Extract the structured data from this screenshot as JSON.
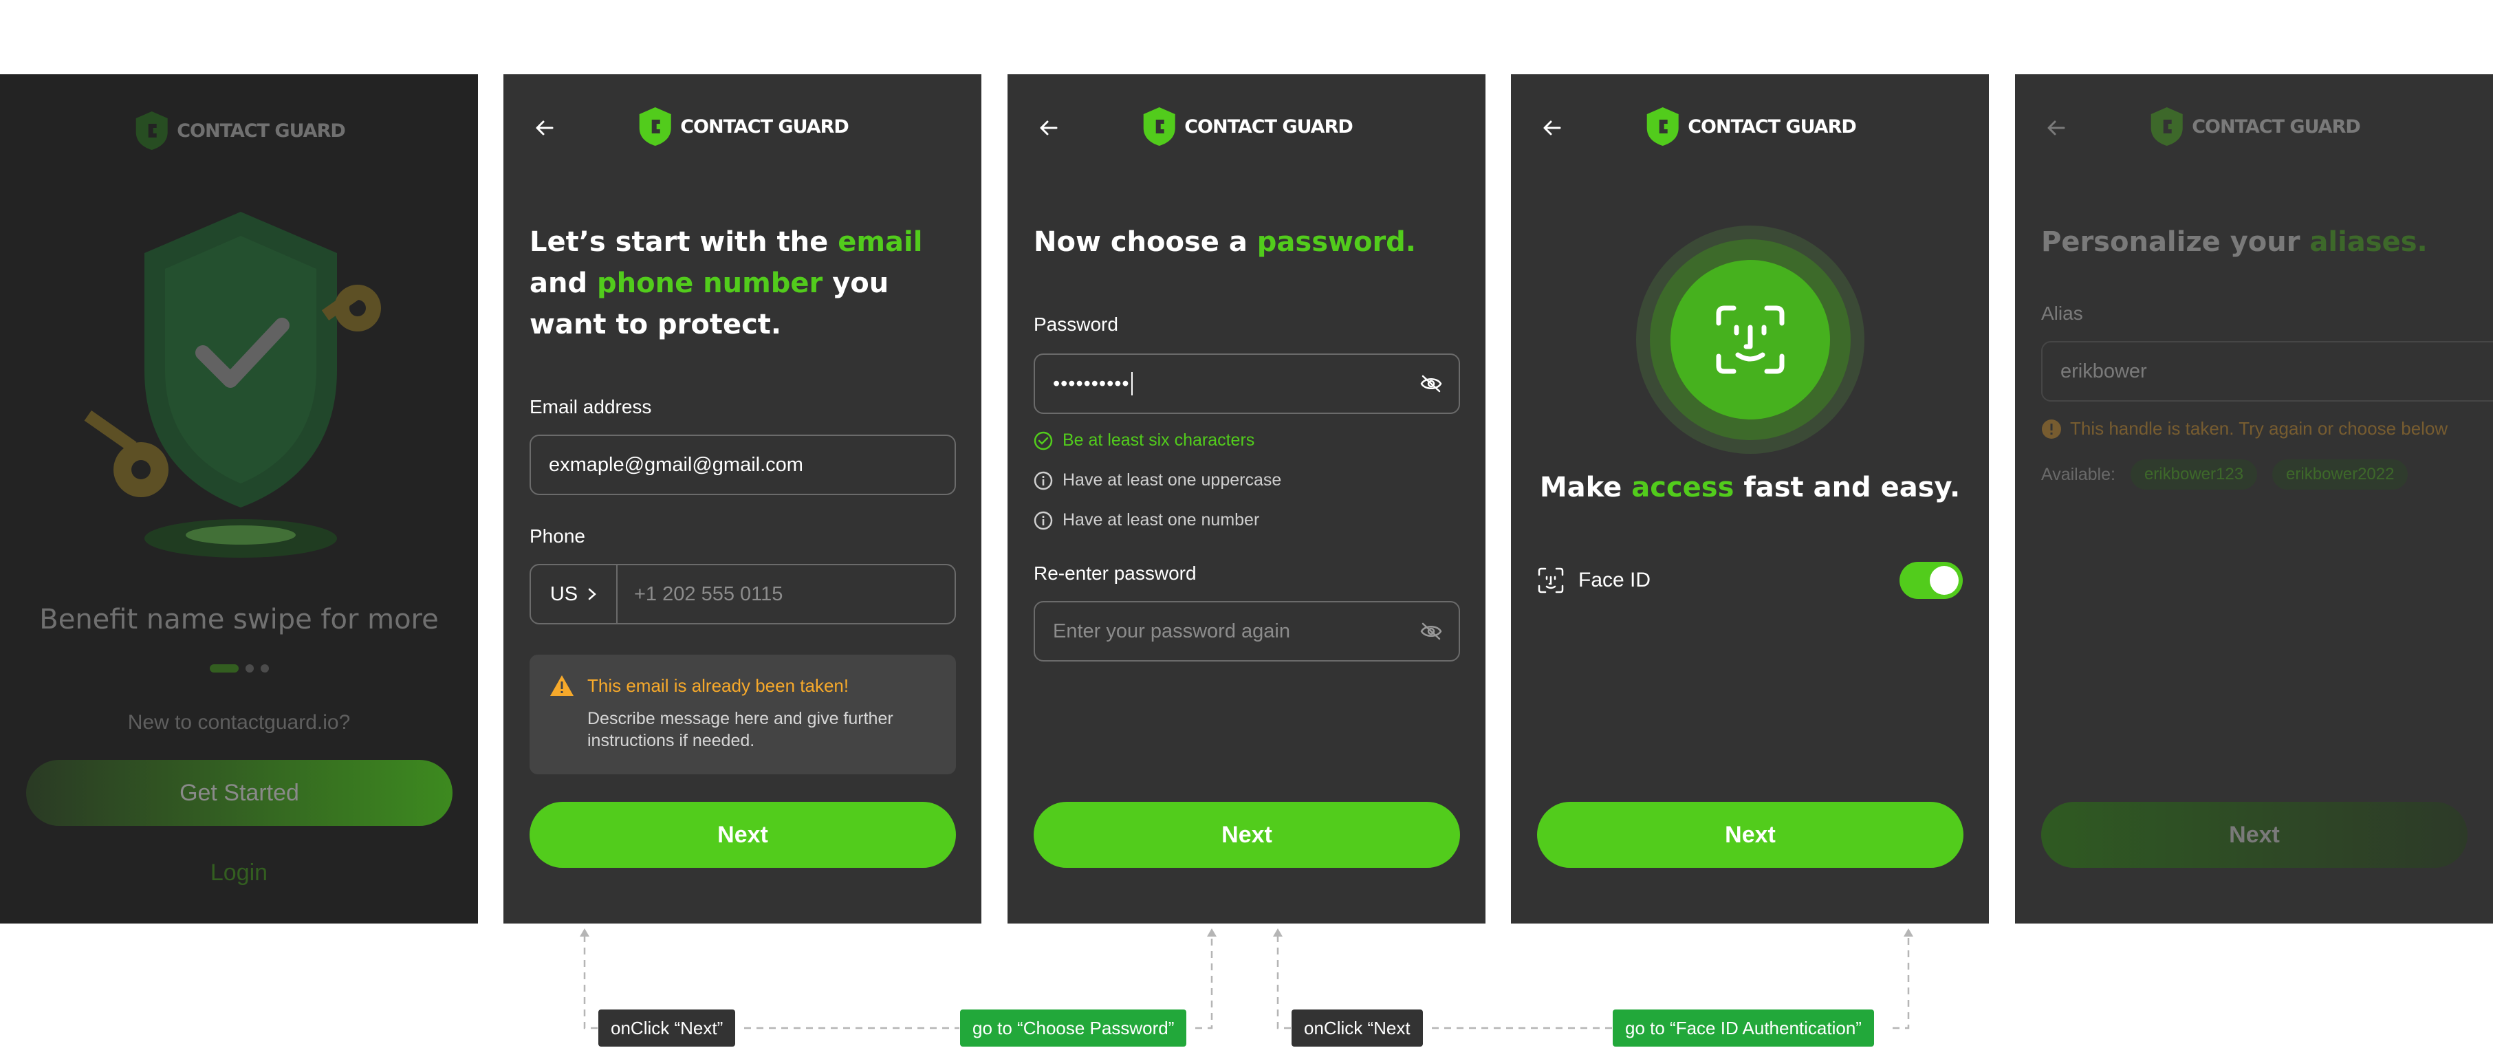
{
  "brand": {
    "name": "CONTACT GUARD",
    "accent": "#52cc1c",
    "screen_bg": "#333333"
  },
  "screen1": {
    "tagline": "Benefit name swipe for more",
    "new_user": "New to contactguard.io?",
    "get_started": "Get Started",
    "login": "Login",
    "pagination": {
      "total": 3,
      "active": 1
    }
  },
  "screen2": {
    "title_part1": "Let’s start with the ",
    "title_accent1": "email",
    "title_part2": " and ",
    "title_accent2": "phone number",
    "title_part3": " you want to protect.",
    "email_label": "Email address",
    "email_value": "exmaple@gmail@gmail.com",
    "phone_label": "Phone",
    "country": "US",
    "phone_placeholder": "+1 202 555 0115",
    "alert_title": "This email is already been taken!",
    "alert_body": "Describe message here and give further instructions if needed.",
    "next": "Next"
  },
  "screen3": {
    "title_part1": "Now choose a ",
    "title_accent": "password.",
    "password_label": "Password",
    "password_value": "••••••••••",
    "rules": [
      {
        "text": "Be at least six characters",
        "met": true
      },
      {
        "text": "Have at least one uppercase",
        "met": false
      },
      {
        "text": "Have at least one number",
        "met": false
      }
    ],
    "reenter_label": "Re-enter password",
    "reenter_placeholder": "Enter your password again",
    "next": "Next"
  },
  "screen4": {
    "title_part1": "Make ",
    "title_accent": "access",
    "title_part2": " fast and easy.",
    "faceid_label": "Face ID",
    "faceid_enabled": true,
    "next": "Next"
  },
  "screen5": {
    "title_part1": "Personalize your ",
    "title_accent": "aliases.",
    "alias_label": "Alias",
    "alias_value": "erikbower",
    "error": "This handle is taken. Try again or choose below",
    "available_label": "Available:",
    "suggestions": [
      "erikbower123",
      "erikbower2022"
    ],
    "next": "Next"
  },
  "annotations": [
    {
      "text": "onClick “Next”"
    },
    {
      "text": "go to “Choose Password”"
    },
    {
      "text": "onClick “Next"
    },
    {
      "text": "go to “Face ID Authentication”"
    }
  ]
}
